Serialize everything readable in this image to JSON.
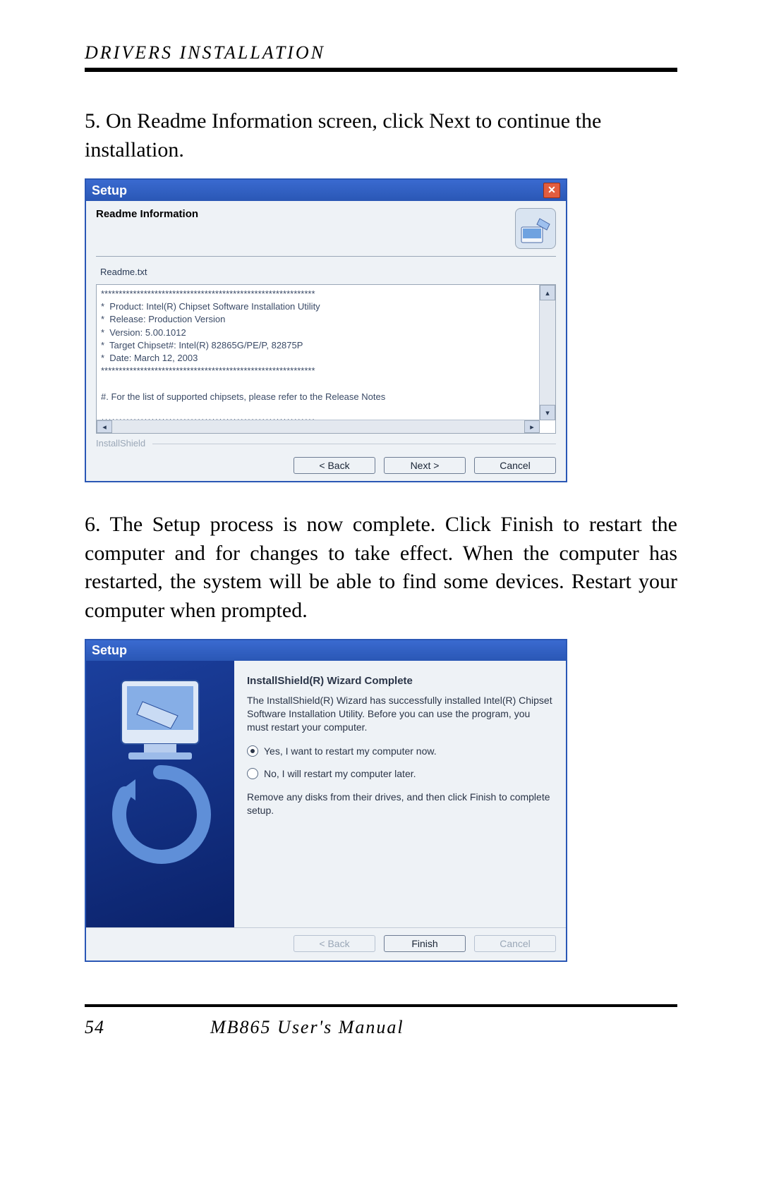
{
  "header": {
    "section": "DRIVERS INSTALLATION"
  },
  "step5_text": "5. On Readme Information screen, click Next to continue the installation.",
  "step6_text": "6. The Setup process is now complete.  Click Finish to restart the computer and for changes to take effect. When the computer has restarted, the system will be able to find some devices. Restart your computer when prompted.",
  "dialog1": {
    "title": "Setup",
    "heading": "Readme Information",
    "file_label": "Readme.txt",
    "readme_text": "************************************************************\n*  Product: Intel(R) Chipset Software Installation Utility\n*  Release: Production Version\n*  Version: 5.00.1012\n*  Target Chipset#: Intel(R) 82865G/PE/P, 82875P\n*  Date: March 12, 2003\n************************************************************\n\n#. For the list of supported chipsets, please refer to the Release Notes\n\n************************************************************\n*  CONTENTS OF THIS DOCUMENT",
    "brand": "InstallShield",
    "buttons": {
      "back": "< Back",
      "next": "Next >",
      "cancel": "Cancel"
    }
  },
  "dialog2": {
    "title": "Setup",
    "heading": "InstallShield(R) Wizard Complete",
    "desc": "The InstallShield(R) Wizard has successfully installed Intel(R) Chipset Software Installation Utility.  Before you can use the program, you must restart your computer.",
    "radio_yes": "Yes, I want to restart my computer now.",
    "radio_no": "No, I will restart my computer later.",
    "note": "Remove any disks from their drives, and then click Finish to complete setup.",
    "buttons": {
      "back": "< Back",
      "finish": "Finish",
      "cancel": "Cancel"
    }
  },
  "footer": {
    "page": "54",
    "doc": "MB865 User's Manual"
  }
}
